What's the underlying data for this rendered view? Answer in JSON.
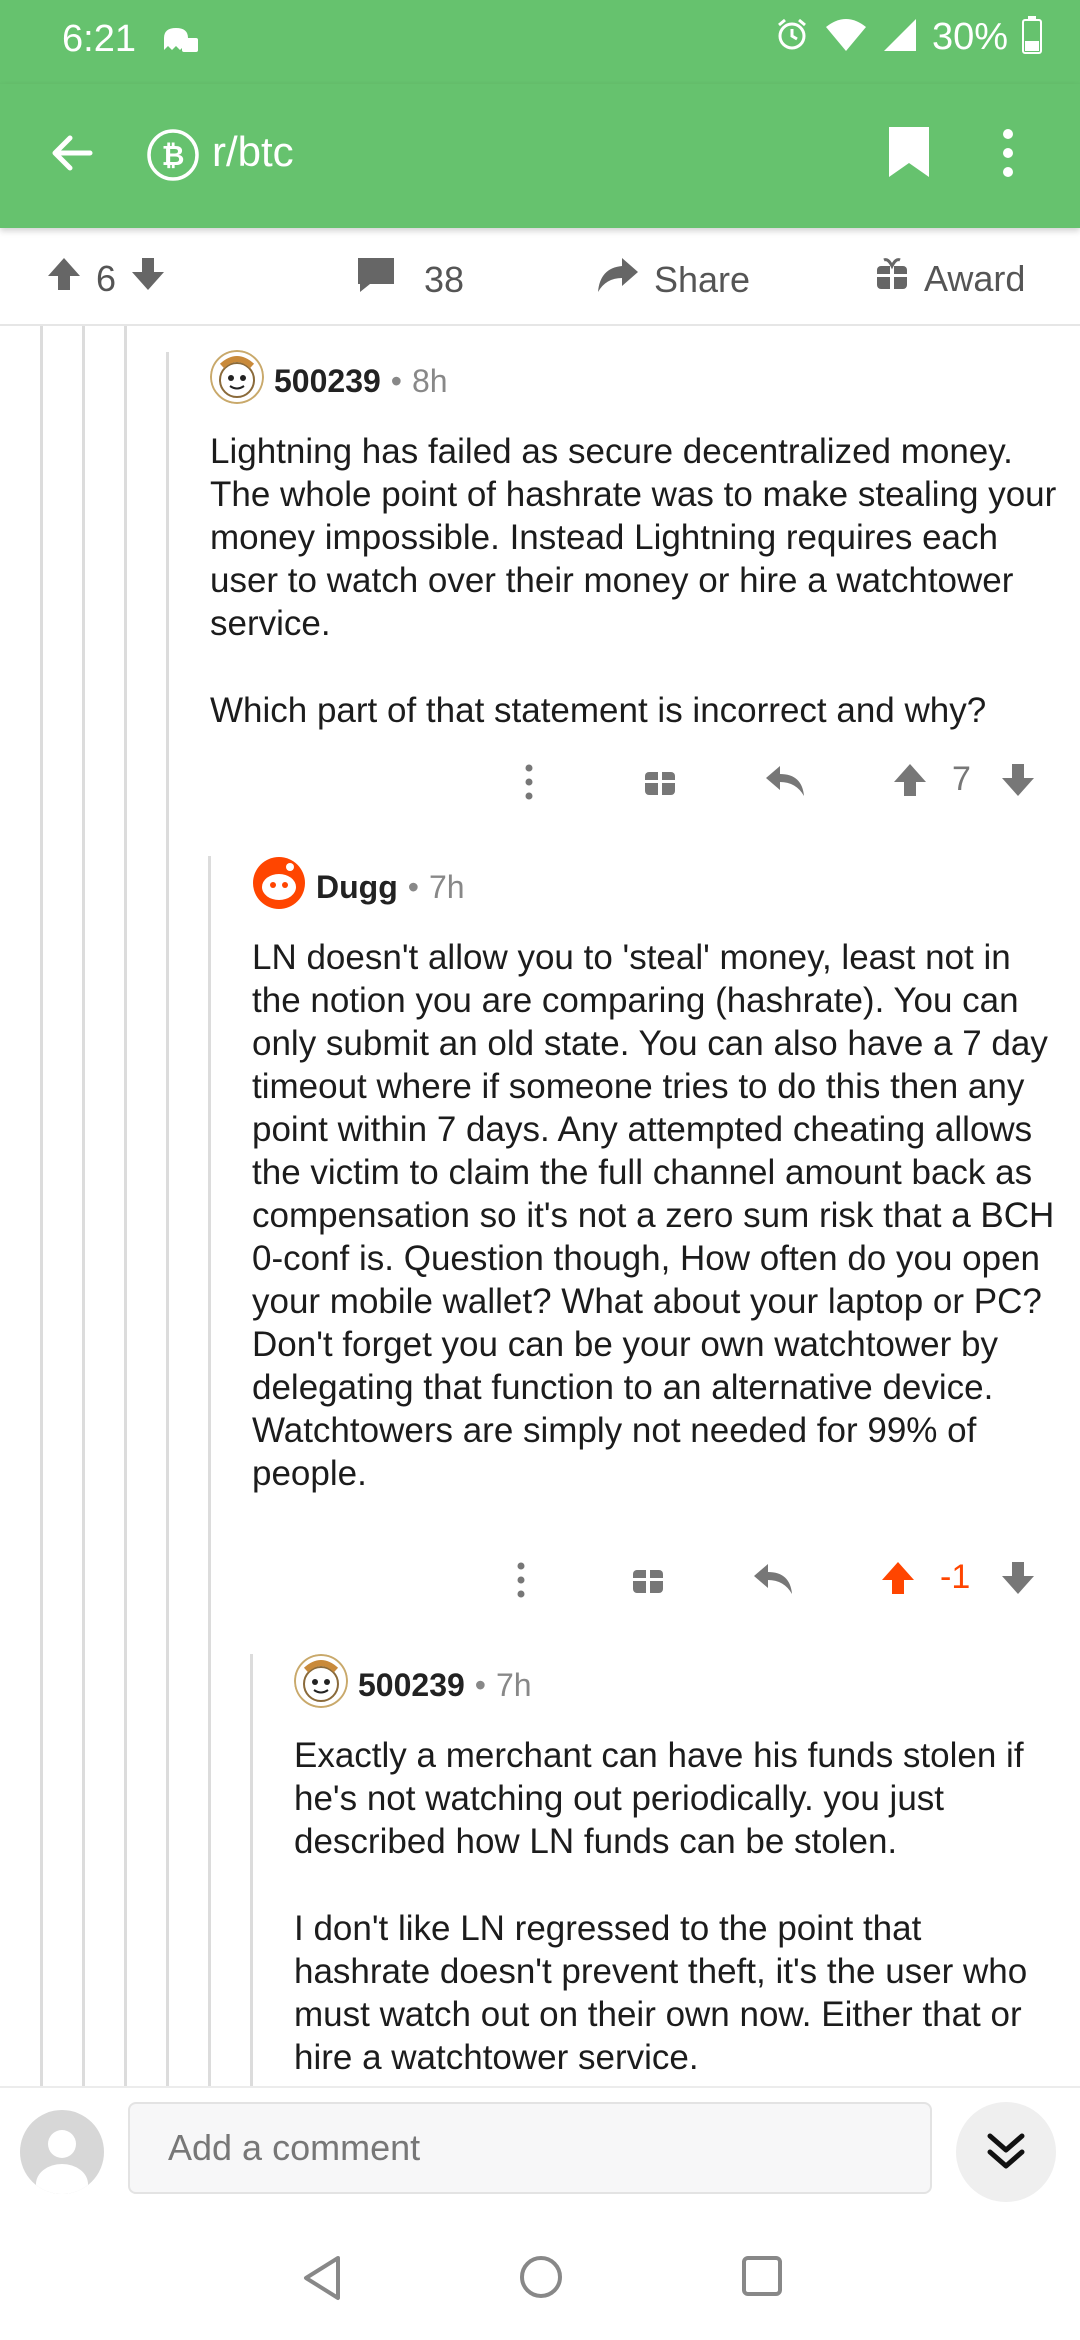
{
  "status_bar": {
    "time": "6:21",
    "battery": "30%",
    "icons": [
      "ghost-icon",
      "alarm-icon",
      "wifi-icon",
      "signal-icon",
      "battery-icon"
    ]
  },
  "toolbar": {
    "subreddit": "r/btc",
    "icons": [
      "back-arrow-icon",
      "bitcoin-icon",
      "bookmark-icon",
      "more-vertical-icon"
    ]
  },
  "post_actions": {
    "votes": "6",
    "comments": "38",
    "share": "Share",
    "award": "Award"
  },
  "comments": [
    {
      "author": "500239",
      "time": "8h",
      "paragraphs": [
        "Lightning has failed as secure decentralized money. The whole point of hashrate was to make stealing your money impossible. Instead Lightning requires each user to watch over their money or hire a watchtower service.",
        "Which part of that statement is incorrect and why?"
      ],
      "score": "7",
      "upvoted": false
    },
    {
      "author": "Dugg",
      "time": "7h",
      "paragraphs": [
        "LN doesn't allow you to 'steal' money, least not in the notion you are comparing (hashrate). You can only submit an old state. You can also have a 7 day timeout where if someone tries to do this then any point within 7 days. Any attempted cheating allows the victim to claim the full channel amount back as compensation so it's not a zero sum risk that a BCH 0-conf is. Question though, How often do you open your mobile wallet? What about your laptop or PC? Don't forget you can be your own watchtower by delegating that function to an alternative device. Watchtowers are simply not needed for 99% of people."
      ],
      "score": "-1",
      "upvoted": true
    },
    {
      "author": "500239",
      "time": "7h",
      "paragraphs": [
        "Exactly a merchant can have his funds stolen if he's not watching out periodically. you just described how LN funds can be stolen.",
        "I don't like LN regressed to the point that hashrate doesn't prevent theft, it's the user who must watch out on their own now. Either that or hire a watchtower service."
      ]
    }
  ],
  "meta_separator": "•",
  "compose": {
    "placeholder": "Add a comment"
  },
  "colors": {
    "brand_green": "#66c26e",
    "upvote_orange": "#ff4500",
    "icon_gray": "#777777"
  }
}
